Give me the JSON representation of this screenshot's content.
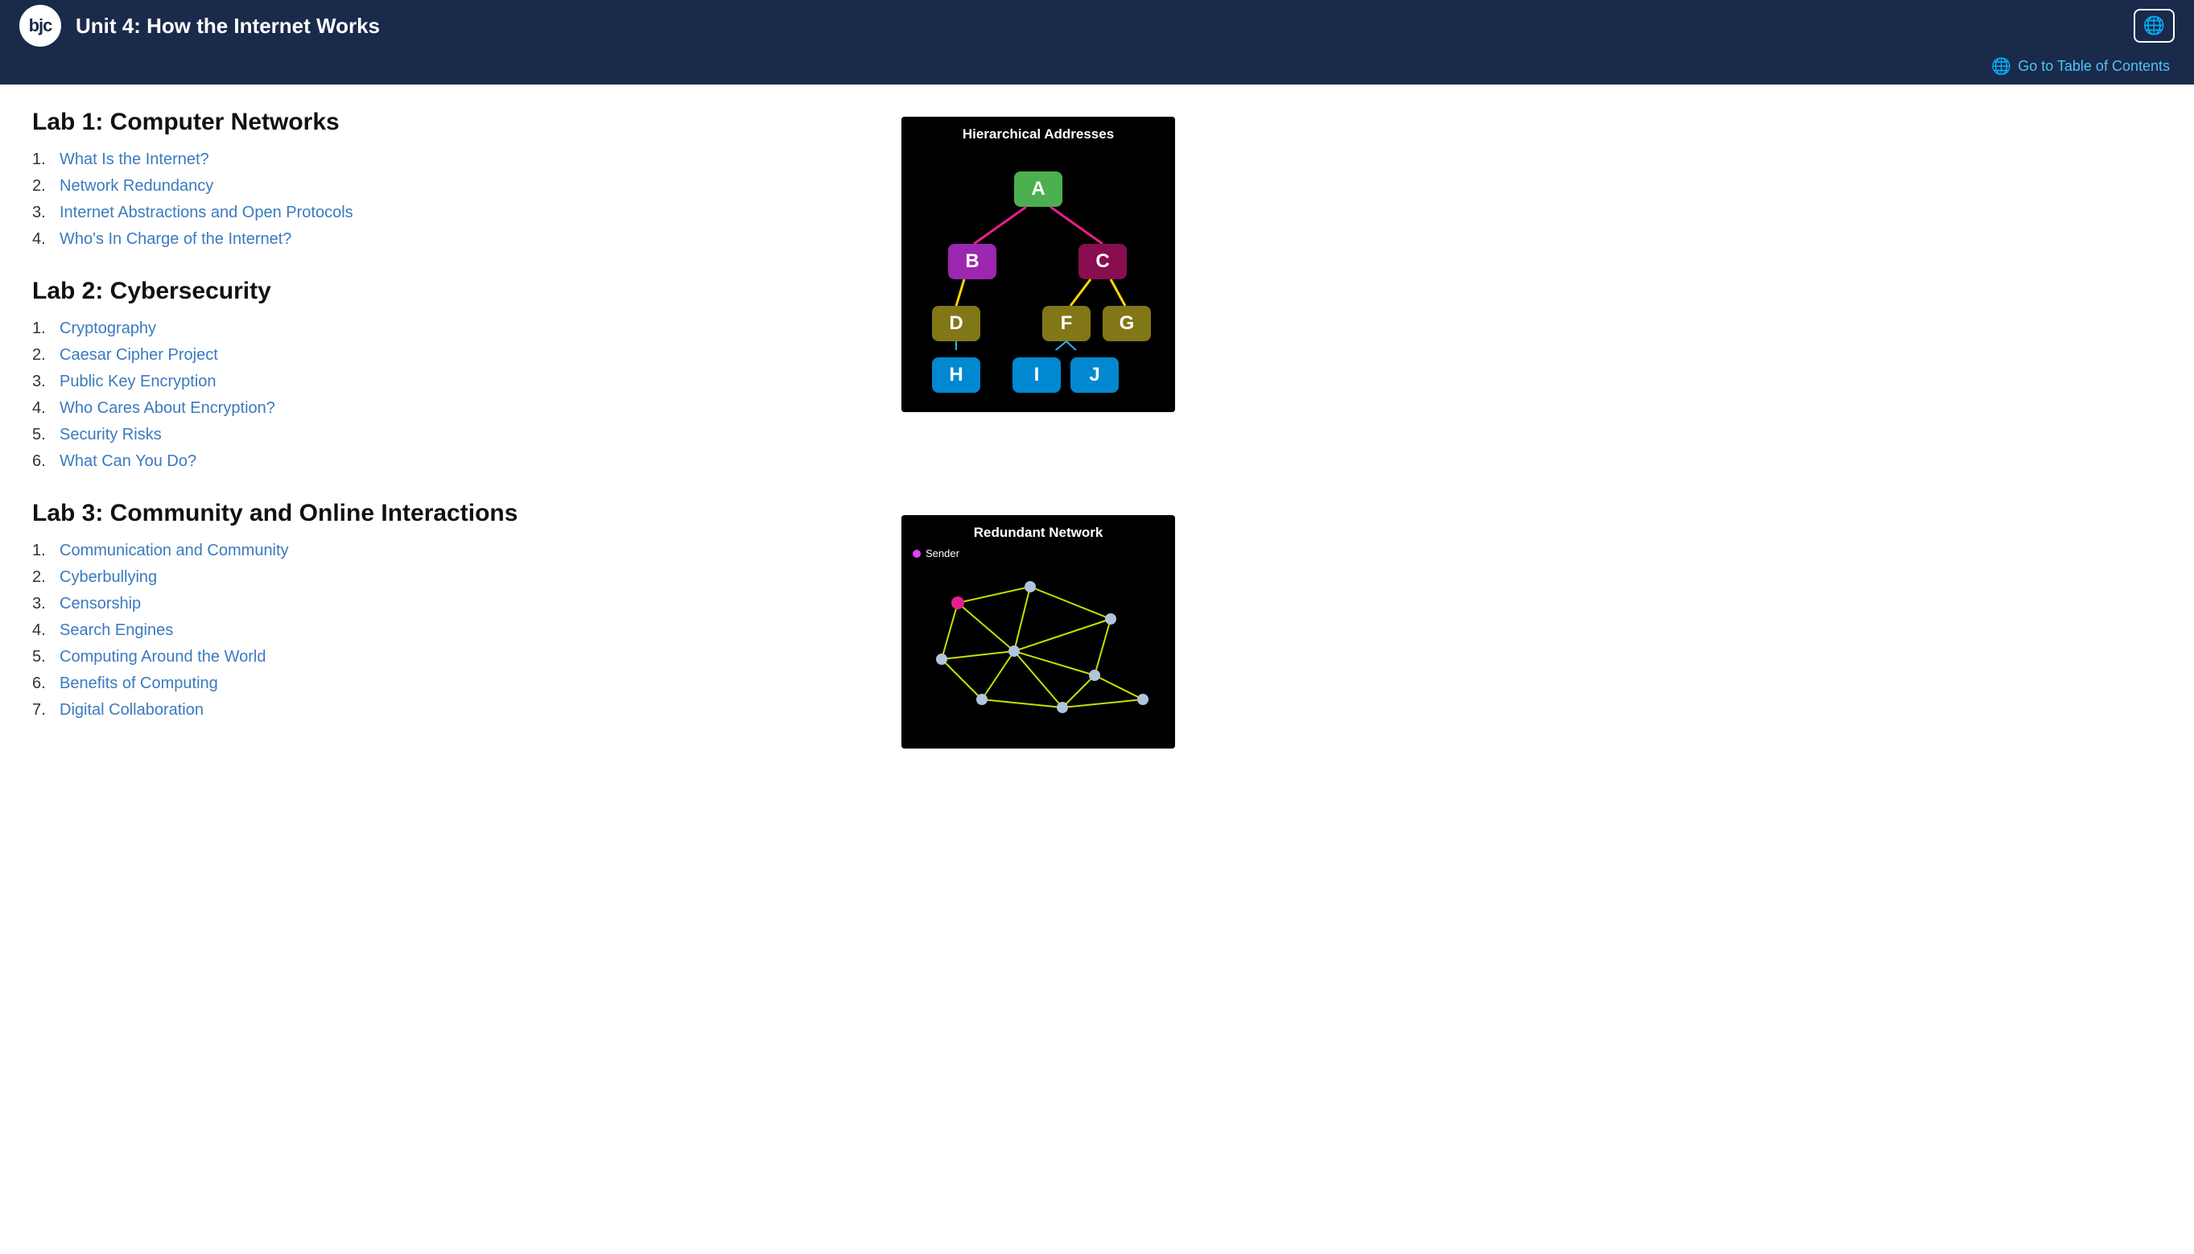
{
  "header": {
    "logo_text": "bjc",
    "title": "Unit 4: How the Internet Works",
    "globe_icon": "🌐"
  },
  "toc": {
    "link_text": "Go to Table of Contents",
    "globe_icon": "🌐"
  },
  "labs": [
    {
      "id": "lab1",
      "title": "Lab 1: Computer Networks",
      "items": [
        {
          "num": "1.",
          "label": "What Is the Internet?"
        },
        {
          "num": "2.",
          "label": "Network Redundancy"
        },
        {
          "num": "3.",
          "label": "Internet Abstractions and Open Protocols"
        },
        {
          "num": "4.",
          "label": "Who's In Charge of the Internet?"
        }
      ]
    },
    {
      "id": "lab2",
      "title": "Lab 2: Cybersecurity",
      "items": [
        {
          "num": "1.",
          "label": "Cryptography"
        },
        {
          "num": "2.",
          "label": "Caesar Cipher Project"
        },
        {
          "num": "3.",
          "label": "Public Key Encryption"
        },
        {
          "num": "4.",
          "label": "Who Cares About Encryption?"
        },
        {
          "num": "5.",
          "label": "Security Risks"
        },
        {
          "num": "6.",
          "label": "What Can You Do?"
        }
      ]
    },
    {
      "id": "lab3",
      "title": "Lab 3: Community and Online Interactions",
      "items": [
        {
          "num": "1.",
          "label": "Communication and Community"
        },
        {
          "num": "2.",
          "label": "Cyberbullying"
        },
        {
          "num": "3.",
          "label": "Censorship"
        },
        {
          "num": "4.",
          "label": "Search Engines"
        },
        {
          "num": "5.",
          "label": "Computing Around the World"
        },
        {
          "num": "6.",
          "label": "Benefits of Computing"
        },
        {
          "num": "7.",
          "label": "Digital Collaboration"
        }
      ]
    }
  ],
  "image1": {
    "title": "Hierarchical Addresses"
  },
  "image2": {
    "title": "Redundant Network",
    "sender_label": "Sender"
  }
}
